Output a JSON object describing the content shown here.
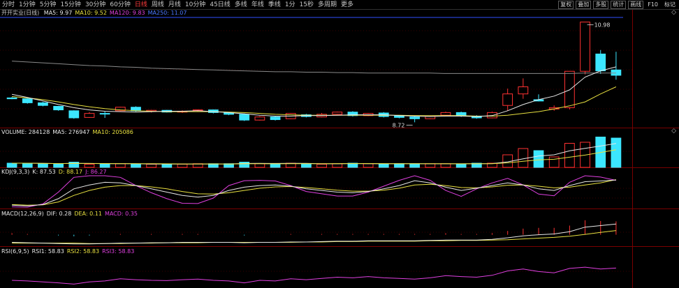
{
  "toolbar": {
    "period_tabs": [
      "分时",
      "1分钟",
      "5分钟",
      "15分钟",
      "30分钟",
      "60分钟",
      "日线",
      "周线",
      "月线",
      "10分钟",
      "45日线",
      "多线",
      "年线",
      "季线",
      "1分",
      "15秒",
      "多周期",
      "更多"
    ],
    "active_tab": 6,
    "right_buttons": [
      "复权",
      "叠加",
      "多股",
      "统计",
      "画线",
      "F10",
      "标记"
    ]
  },
  "colors": {
    "up": "#ff3232",
    "down": "#3ce6ff",
    "ma_white": "#e8e8e8",
    "ma_yellow": "#e8e040",
    "ma_magenta": "#e040e0",
    "ma_gray": "#8a8a8a",
    "panel_border": "#7a0000"
  },
  "main_panel": {
    "name": "开开实业(日线)",
    "indicators": [
      {
        "label": "MA5: 9.97",
        "color": "white"
      },
      {
        "label": "MA10: 9.52",
        "color": "yellow"
      },
      {
        "label": "MA120: 9.83",
        "color": "magenta"
      },
      {
        "label": "MA250: 11.07",
        "color": "blue"
      }
    ],
    "high_label": "10.98",
    "low_label": "8.72"
  },
  "volume_panel": {
    "indicators": [
      {
        "label": "VOLUME: 284128",
        "color": "white"
      },
      {
        "label": "MA5: 276947",
        "color": "white"
      },
      {
        "label": "MA10: 205086",
        "color": "yellow"
      }
    ]
  },
  "kdj_panel": {
    "indicators": [
      {
        "label": "KDJ(9,3,3)",
        "color": "white"
      },
      {
        "label": "K: 87.53",
        "color": "white"
      },
      {
        "label": "D: 88.17",
        "color": "yellow"
      },
      {
        "label": "J: 86.27",
        "color": "magenta"
      }
    ]
  },
  "macd_panel": {
    "indicators": [
      {
        "label": "MACD(12,26,9)",
        "color": "white"
      },
      {
        "label": "DIF: 0.28",
        "color": "white"
      },
      {
        "label": "DEA: 0.11",
        "color": "yellow"
      },
      {
        "label": "MACD: 0.35",
        "color": "magenta"
      }
    ]
  },
  "rsi_panel": {
    "indicators": [
      {
        "label": "RSI(6,9,5)",
        "color": "white"
      },
      {
        "label": "RSI1: 58.83",
        "color": "white"
      },
      {
        "label": "RSI2: 58.83",
        "color": "yellow"
      },
      {
        "label": "RSI3: 58.83",
        "color": "magenta"
      }
    ]
  },
  "nav": {
    "up": "◇",
    "down": "◇"
  },
  "chart_data": {
    "type": "candlestick",
    "candles": [
      {
        "o": 9.27,
        "h": 9.29,
        "l": 9.24,
        "c": 9.25
      },
      {
        "o": 9.25,
        "h": 9.26,
        "l": 9.14,
        "c": 9.16
      },
      {
        "o": 9.16,
        "h": 9.18,
        "l": 9.08,
        "c": 9.1
      },
      {
        "o": 9.08,
        "h": 9.09,
        "l": 8.98,
        "c": 9.0
      },
      {
        "o": 8.98,
        "h": 8.99,
        "l": 8.8,
        "c": 8.82
      },
      {
        "o": 8.83,
        "h": 8.95,
        "l": 8.82,
        "c": 8.92
      },
      {
        "o": 8.92,
        "h": 8.96,
        "l": 8.82,
        "c": 8.91
      },
      {
        "o": 8.98,
        "h": 9.07,
        "l": 8.97,
        "c": 9.06
      },
      {
        "o": 9.06,
        "h": 9.08,
        "l": 8.96,
        "c": 8.98
      },
      {
        "o": 8.97,
        "h": 9.0,
        "l": 8.94,
        "c": 8.99
      },
      {
        "o": 8.99,
        "h": 9.0,
        "l": 8.94,
        "c": 8.95
      },
      {
        "o": 8.95,
        "h": 8.99,
        "l": 8.93,
        "c": 8.97
      },
      {
        "o": 8.99,
        "h": 9.01,
        "l": 8.96,
        "c": 9.0
      },
      {
        "o": 9.0,
        "h": 9.01,
        "l": 8.92,
        "c": 8.94
      },
      {
        "o": 8.94,
        "h": 8.95,
        "l": 8.88,
        "c": 8.9
      },
      {
        "o": 8.9,
        "h": 8.92,
        "l": 8.75,
        "c": 8.77
      },
      {
        "o": 8.77,
        "h": 8.86,
        "l": 8.76,
        "c": 8.84
      },
      {
        "o": 8.84,
        "h": 8.86,
        "l": 8.76,
        "c": 8.78
      },
      {
        "o": 8.8,
        "h": 8.93,
        "l": 8.79,
        "c": 8.92
      },
      {
        "o": 8.89,
        "h": 8.91,
        "l": 8.83,
        "c": 8.85
      },
      {
        "o": 8.84,
        "h": 8.93,
        "l": 8.83,
        "c": 8.9
      },
      {
        "o": 8.9,
        "h": 8.96,
        "l": 8.89,
        "c": 8.95
      },
      {
        "o": 8.95,
        "h": 8.97,
        "l": 8.85,
        "c": 8.87
      },
      {
        "o": 8.87,
        "h": 8.93,
        "l": 8.86,
        "c": 8.92
      },
      {
        "o": 8.93,
        "h": 8.95,
        "l": 8.83,
        "c": 8.85
      },
      {
        "o": 8.86,
        "h": 8.88,
        "l": 8.81,
        "c": 8.83
      },
      {
        "o": 8.84,
        "h": 8.86,
        "l": 8.72,
        "c": 8.8
      },
      {
        "o": 8.8,
        "h": 8.86,
        "l": 8.79,
        "c": 8.85
      },
      {
        "o": 8.88,
        "h": 8.96,
        "l": 8.87,
        "c": 8.94
      },
      {
        "o": 8.94,
        "h": 8.96,
        "l": 8.84,
        "c": 8.86
      },
      {
        "o": 8.86,
        "h": 8.88,
        "l": 8.8,
        "c": 8.82
      },
      {
        "o": 8.82,
        "h": 8.96,
        "l": 8.81,
        "c": 8.94
      },
      {
        "o": 9.1,
        "h": 9.48,
        "l": 8.98,
        "c": 9.36
      },
      {
        "o": 9.36,
        "h": 9.71,
        "l": 9.25,
        "c": 9.52
      },
      {
        "o": 9.23,
        "h": 9.35,
        "l": 9.19,
        "c": 9.2
      },
      {
        "o": 9.02,
        "h": 9.1,
        "l": 8.98,
        "c": 9.05
      },
      {
        "o": 9.05,
        "h": 9.87,
        "l": 9.01,
        "c": 9.87
      },
      {
        "o": 9.87,
        "h": 10.98,
        "l": 9.8,
        "c": 10.98
      },
      {
        "o": 10.26,
        "h": 10.35,
        "l": 9.81,
        "c": 9.88
      },
      {
        "o": 9.9,
        "h": 10.31,
        "l": 9.68,
        "c": 9.78
      }
    ],
    "volume": [
      40,
      40,
      35,
      30,
      50,
      30,
      30,
      35,
      30,
      30,
      30,
      30,
      35,
      35,
      35,
      50,
      35,
      30,
      40,
      35,
      30,
      35,
      40,
      35,
      30,
      35,
      35,
      35,
      35,
      30,
      40,
      40,
      120,
      180,
      160,
      100,
      230,
      240,
      290,
      280
    ],
    "ma5": [
      9.35,
      9.28,
      9.2,
      9.12,
      9.05,
      9.0,
      8.97,
      8.96,
      8.95,
      8.96,
      8.97,
      8.97,
      8.98,
      8.96,
      8.94,
      8.91,
      8.88,
      8.86,
      8.86,
      8.87,
      8.87,
      8.88,
      8.89,
      8.89,
      8.89,
      8.87,
      8.86,
      8.85,
      8.86,
      8.86,
      8.85,
      8.87,
      8.98,
      9.12,
      9.23,
      9.31,
      9.45,
      9.74,
      9.88,
      9.97
    ],
    "ma10": [
      9.3,
      9.27,
      9.23,
      9.18,
      9.12,
      9.07,
      9.03,
      9.0,
      8.98,
      8.97,
      8.96,
      8.96,
      8.96,
      8.96,
      8.95,
      8.94,
      8.92,
      8.9,
      8.89,
      8.88,
      8.88,
      8.88,
      8.88,
      8.88,
      8.88,
      8.88,
      8.87,
      8.87,
      8.87,
      8.87,
      8.86,
      8.86,
      8.88,
      8.92,
      8.96,
      9.02,
      9.09,
      9.18,
      9.36,
      9.52
    ],
    "ma120": [
      10.1,
      10.08,
      10.06,
      10.04,
      10.02,
      10.0,
      9.99,
      9.97,
      9.96,
      9.94,
      9.93,
      9.92,
      9.91,
      9.9,
      9.89,
      9.88,
      9.87,
      9.86,
      9.86,
      9.85,
      9.85,
      9.84,
      9.84,
      9.83,
      9.83,
      9.83,
      9.83,
      9.83,
      9.82,
      9.82,
      9.82,
      9.82,
      9.82,
      9.82,
      9.82,
      9.82,
      9.82,
      9.83,
      9.83,
      9.83
    ],
    "kdj_k": [
      10,
      8,
      12,
      30,
      60,
      72,
      80,
      78,
      70,
      60,
      50,
      40,
      35,
      40,
      55,
      65,
      70,
      72,
      68,
      60,
      55,
      50,
      48,
      52,
      60,
      70,
      85,
      78,
      65,
      55,
      62,
      70,
      78,
      72,
      60,
      55,
      70,
      82,
      84,
      87
    ],
    "kdj_d": [
      12,
      10,
      11,
      20,
      40,
      55,
      65,
      70,
      70,
      66,
      60,
      52,
      45,
      44,
      48,
      55,
      62,
      66,
      67,
      64,
      60,
      56,
      53,
      53,
      56,
      62,
      72,
      74,
      70,
      64,
      63,
      66,
      71,
      72,
      68,
      63,
      65,
      72,
      78,
      88
    ],
    "kdj_j": [
      5,
      4,
      14,
      50,
      95,
      100,
      100,
      95,
      70,
      48,
      30,
      16,
      15,
      32,
      70,
      85,
      86,
      84,
      70,
      52,
      45,
      38,
      38,
      50,
      68,
      86,
      100,
      86,
      55,
      37,
      60,
      78,
      92,
      72,
      44,
      39,
      80,
      100,
      96,
      86
    ],
    "macd_dif": [
      -0.2,
      -0.21,
      -0.22,
      -0.23,
      -0.24,
      -0.24,
      -0.23,
      -0.22,
      -0.22,
      -0.21,
      -0.21,
      -0.2,
      -0.2,
      -0.2,
      -0.2,
      -0.21,
      -0.2,
      -0.2,
      -0.19,
      -0.19,
      -0.18,
      -0.17,
      -0.17,
      -0.16,
      -0.16,
      -0.16,
      -0.16,
      -0.15,
      -0.14,
      -0.14,
      -0.14,
      -0.12,
      -0.08,
      -0.03,
      0.0,
      0.02,
      0.08,
      0.2,
      0.24,
      0.28
    ],
    "macd_dea": [
      -0.22,
      -0.22,
      -0.22,
      -0.22,
      -0.22,
      -0.23,
      -0.23,
      -0.23,
      -0.22,
      -0.22,
      -0.21,
      -0.21,
      -0.21,
      -0.2,
      -0.2,
      -0.2,
      -0.2,
      -0.2,
      -0.2,
      -0.19,
      -0.19,
      -0.18,
      -0.18,
      -0.17,
      -0.17,
      -0.17,
      -0.17,
      -0.16,
      -0.16,
      -0.15,
      -0.15,
      -0.14,
      -0.13,
      -0.11,
      -0.09,
      -0.07,
      -0.04,
      0.01,
      0.06,
      0.11
    ],
    "macd_hist": [
      0.04,
      0.02,
      0.0,
      -0.02,
      -0.04,
      -0.02,
      0.0,
      0.02,
      0.0,
      0.02,
      0.0,
      0.02,
      0.02,
      0.0,
      0.0,
      -0.02,
      0.0,
      0.0,
      0.02,
      0.0,
      0.02,
      0.02,
      0.02,
      0.02,
      0.02,
      0.02,
      0.02,
      0.02,
      0.04,
      0.02,
      0.02,
      0.04,
      0.1,
      0.16,
      0.18,
      0.18,
      0.24,
      0.38,
      0.36,
      0.35
    ],
    "rsi": [
      20,
      18,
      15,
      12,
      8,
      15,
      18,
      25,
      22,
      20,
      19,
      22,
      24,
      20,
      18,
      12,
      20,
      18,
      25,
      22,
      26,
      30,
      28,
      32,
      28,
      26,
      24,
      28,
      35,
      32,
      30,
      36,
      50,
      56,
      48,
      44,
      58,
      62,
      56,
      59
    ],
    "price_range": [
      8.6,
      11.1
    ],
    "volume_range": [
      0,
      300
    ],
    "kdj_range": [
      0,
      100
    ],
    "macd_range": [
      -0.3,
      0.45
    ],
    "rsi_range": [
      0,
      100
    ]
  }
}
